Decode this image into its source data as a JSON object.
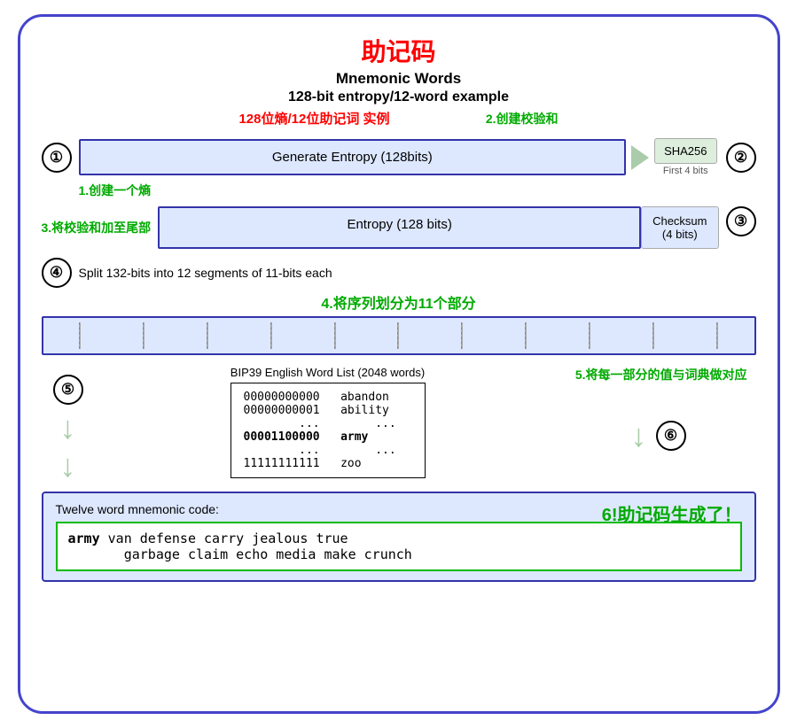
{
  "title": {
    "cn": "助记码",
    "en1": "Mnemonic Words",
    "en2": "128-bit entropy/12-word example",
    "cn2": "128位熵/12位助记词 实例"
  },
  "labels": {
    "step1_cn": "1.创建一个熵",
    "step2_cn": "2.创建校验和",
    "step3_cn": "3.将校验和加至尾部",
    "step4_cn": "4.将序列划分为11个部分",
    "step5_cn": "5.将每一部分的值与词典做对应",
    "step6_cn": "6!助记码生成了！",
    "generate_entropy": "Generate Entropy (128bits)",
    "sha256": "SHA256",
    "first4bits": "First 4 bits",
    "entropy_128": "Entropy (128 bits)",
    "checksum": "Checksum\n(4 bits)",
    "split_desc": "Split 132-bits into 12 segments of 11-bits each",
    "wordlist_title": "BIP39 English Word List (2048 words)",
    "mnemonic_label": "Twelve word mnemonic code:",
    "mnemonic_text": "army van defense carry jealous true\ngarbage claim echo media make crunch",
    "mnemonic_bold_word": "army"
  },
  "wordlist": {
    "rows": [
      {
        "binary": "00000000000",
        "word": "abandon",
        "bold": false
      },
      {
        "binary": "00000000001",
        "word": "ability",
        "bold": false
      },
      {
        "binary": "...",
        "word": "...",
        "bold": false
      },
      {
        "binary": "00001100000",
        "word": "army",
        "bold": true
      },
      {
        "binary": "...",
        "word": "...",
        "bold": false
      },
      {
        "binary": "11111111111",
        "word": "zoo",
        "bold": false
      }
    ]
  },
  "segments": 12
}
